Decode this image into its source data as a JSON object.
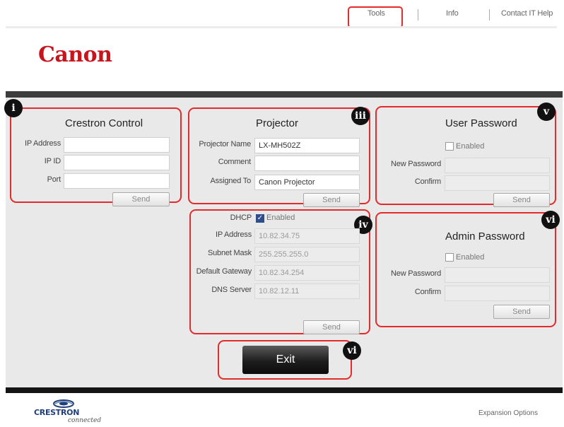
{
  "nav": {
    "tools": "Tools",
    "info": "Info",
    "contact": "Contact IT Help"
  },
  "logo": {
    "text": "Canon"
  },
  "badges": {
    "i": "i",
    "iii": "iii",
    "iv": "iv",
    "v": "v",
    "vi_admin": "vi",
    "vi_exit": "vi"
  },
  "crestron": {
    "title": "Crestron Control",
    "ip_address_label": "IP Address",
    "ip_id_label": "IP ID",
    "port_label": "Port",
    "ip_address_value": "",
    "ip_id_value": "",
    "port_value": "",
    "send_label": "Send"
  },
  "projector": {
    "title": "Projector",
    "name_label": "Projector Name",
    "name_value": "LX-MH502Z",
    "comment_label": "Comment",
    "comment_value": "",
    "assigned_label": "Assigned To",
    "assigned_value": "Canon Projector",
    "send_label": "Send"
  },
  "network": {
    "dhcp_label": "DHCP",
    "dhcp_enabled_label": "Enabled",
    "dhcp_checked": true,
    "ip_label": "IP Address",
    "ip_value": "10.82.34.75",
    "subnet_label": "Subnet Mask",
    "subnet_value": "255.255.255.0",
    "gateway_label": "Default Gateway",
    "gateway_value": "10.82.34.254",
    "dns_label": "DNS Server",
    "dns_value": "10.82.12.11",
    "send_label": "Send"
  },
  "user_password": {
    "title": "User Password",
    "enabled_label": "Enabled",
    "new_label": "New Password",
    "confirm_label": "Confirm",
    "new_value": "",
    "confirm_value": "",
    "send_label": "Send"
  },
  "admin_password": {
    "title": "Admin Password",
    "enabled_label": "Enabled",
    "new_label": "New Password",
    "confirm_label": "Confirm",
    "new_value": "",
    "confirm_value": "",
    "send_label": "Send"
  },
  "exit_label": "Exit",
  "footer": {
    "crestron_word": "CRESTRON",
    "crestron_sub": "connected",
    "expansion_link": "Expansion Options"
  },
  "colors": {
    "highlight_red": "#e32b2b",
    "canon_red": "#c8141c",
    "panel_gray": "#e9e9e9",
    "crestron_blue": "#1f3f7a"
  }
}
